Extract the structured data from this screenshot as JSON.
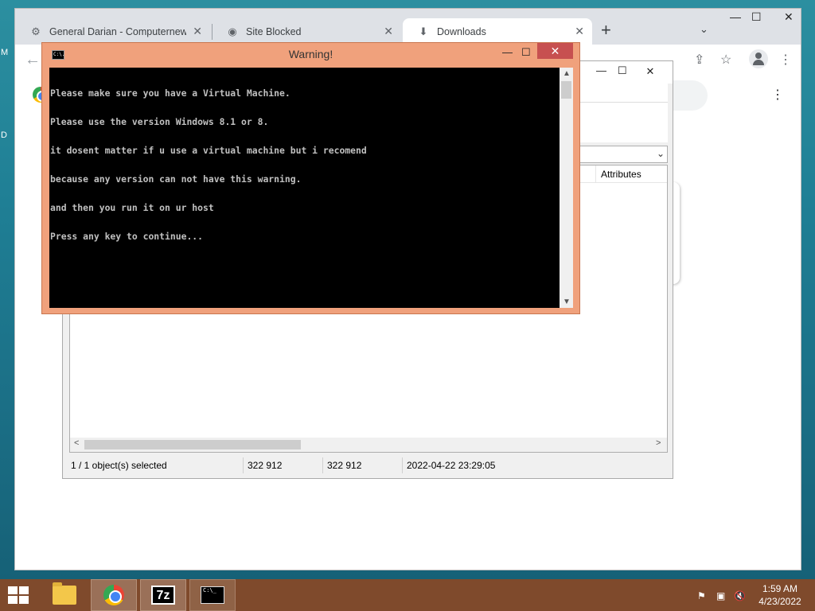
{
  "desktop": {
    "glyph_1": "M",
    "glyph_2": "D"
  },
  "chrome": {
    "tabs": [
      {
        "title": "General Darian - Computernewb",
        "icon": "site-favicon-icon",
        "close": "✕"
      },
      {
        "title": "Site Blocked",
        "icon": "globe-icon",
        "close": "✕"
      },
      {
        "title": "Downloads",
        "icon": "download-icon",
        "close": "✕",
        "active": true
      }
    ],
    "new_tab": "+",
    "tab_search": "⌄",
    "window_controls": {
      "minimize": "—",
      "maximize": "☐",
      "close": "✕"
    },
    "toolbar": {
      "back": "←",
      "share": "⇪",
      "bookmark": "☆",
      "menu": "⋮"
    },
    "downloads_menu": "⋮"
  },
  "sevenzip": {
    "controls": {
      "minimize": "—",
      "maximize": "☐",
      "close": "✕"
    },
    "column_attributes": "Attributes",
    "status": {
      "selected": "1 / 1 object(s) selected",
      "size": "322 912",
      "packed_size": "322 912",
      "modified": "2022-04-22 23:29:05"
    },
    "scroll_left": "<",
    "scroll_right": ">"
  },
  "console": {
    "title": "Warning!",
    "icon_text": "C:\\.",
    "controls": {
      "minimize": "—",
      "maximize": "☐",
      "close": "✕"
    },
    "lines": [
      "Please make sure you have a Virtual Machine.",
      "Please use the version Windows 8.1 or 8.",
      "it dosent matter if u use a virtual machine but i recomend",
      "because any version can not have this warning.",
      "and then you run it on ur host",
      "Press any key to continue..."
    ],
    "scroll_up": "▲",
    "scroll_down": "▼"
  },
  "taskbar": {
    "items": [
      "file-explorer",
      "google-chrome",
      "7-zip",
      "command-prompt"
    ],
    "sevenzip_label": "7z",
    "cmd_label": "C:\\_",
    "tray": {
      "flag": "⚑",
      "network": "▣",
      "volume": "🔇"
    },
    "time": "1:59 AM",
    "date": "4/23/2022"
  }
}
